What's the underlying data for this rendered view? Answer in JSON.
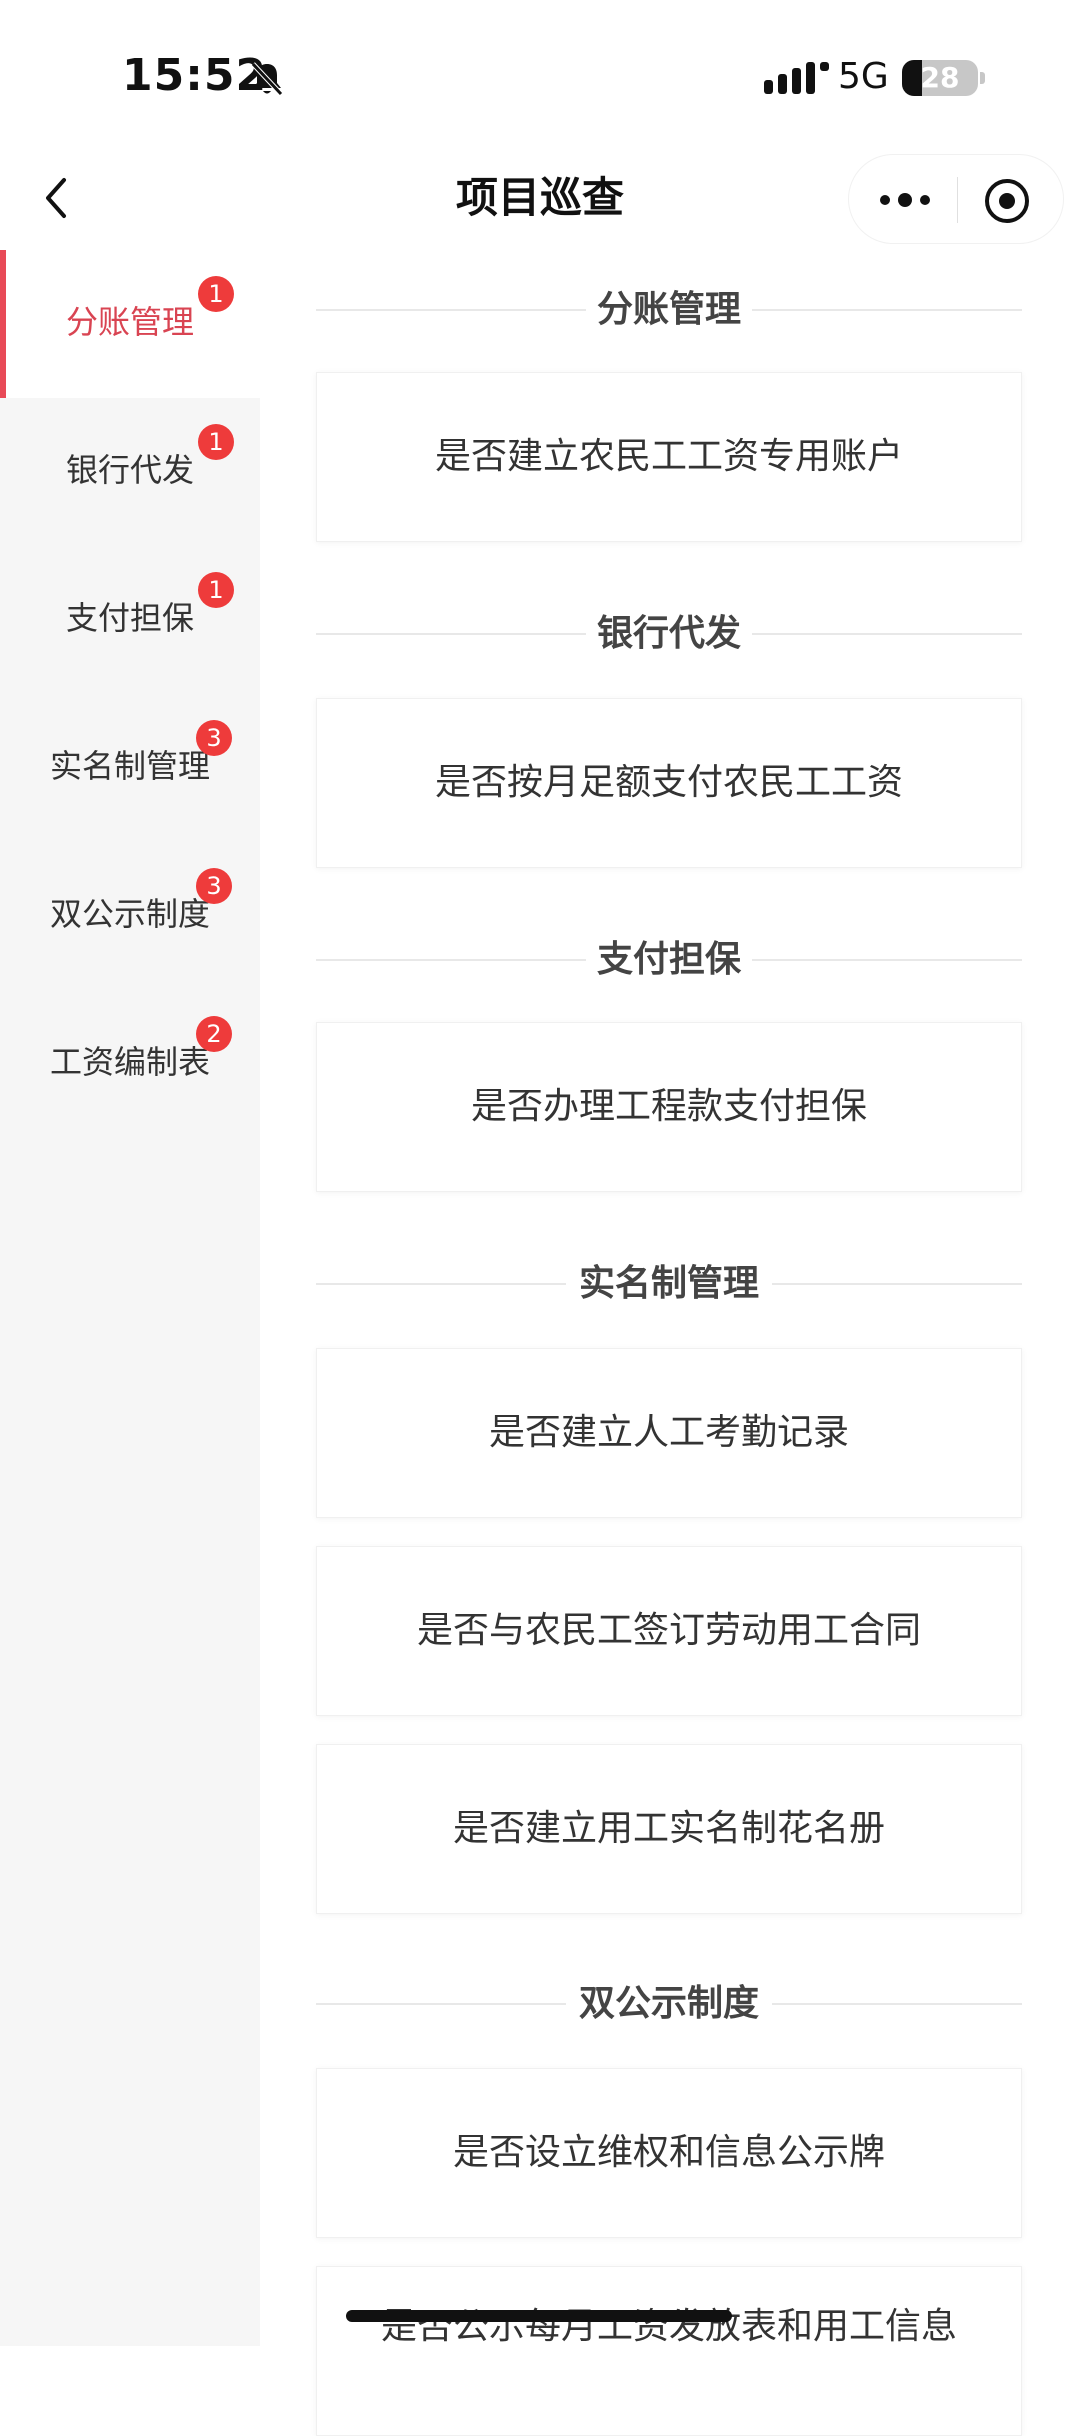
{
  "status_bar": {
    "time": "15:52",
    "network": "5G",
    "battery": "28",
    "icons": [
      "bell-slash-icon",
      "signal-icon"
    ]
  },
  "nav": {
    "title": "项目巡查",
    "icons": [
      "back-icon",
      "more-icon",
      "close-icon"
    ]
  },
  "sidebar": {
    "items": [
      {
        "label": "分账管理",
        "badge": "1",
        "active": true
      },
      {
        "label": "银行代发",
        "badge": "1",
        "active": false
      },
      {
        "label": "支付担保",
        "badge": "1",
        "active": false
      },
      {
        "label": "实名制管理",
        "badge": "3",
        "active": false
      },
      {
        "label": "双公示制度",
        "badge": "3",
        "active": false
      },
      {
        "label": "工资编制表",
        "badge": "2",
        "active": false
      }
    ]
  },
  "sections": [
    {
      "title": "分账管理",
      "questions": [
        "是否建立农民工工资专用账户"
      ]
    },
    {
      "title": "银行代发",
      "questions": [
        "是否按月足额支付农民工工资"
      ]
    },
    {
      "title": "支付担保",
      "questions": [
        "是否办理工程款支付担保"
      ]
    },
    {
      "title": "实名制管理",
      "questions": [
        "是否建立人工考勤记录",
        "是否与农民工签订劳动用工合同",
        "是否建立用工实名制花名册"
      ]
    },
    {
      "title": "双公示制度",
      "questions": [
        "是否设立维权和信息公示牌",
        "是否公示每月工资发放表和用工信息"
      ]
    }
  ],
  "colors": {
    "accent": "#e84a57",
    "badge": "#ee3b3b",
    "sidebar_bg": "#f6f6f6"
  }
}
